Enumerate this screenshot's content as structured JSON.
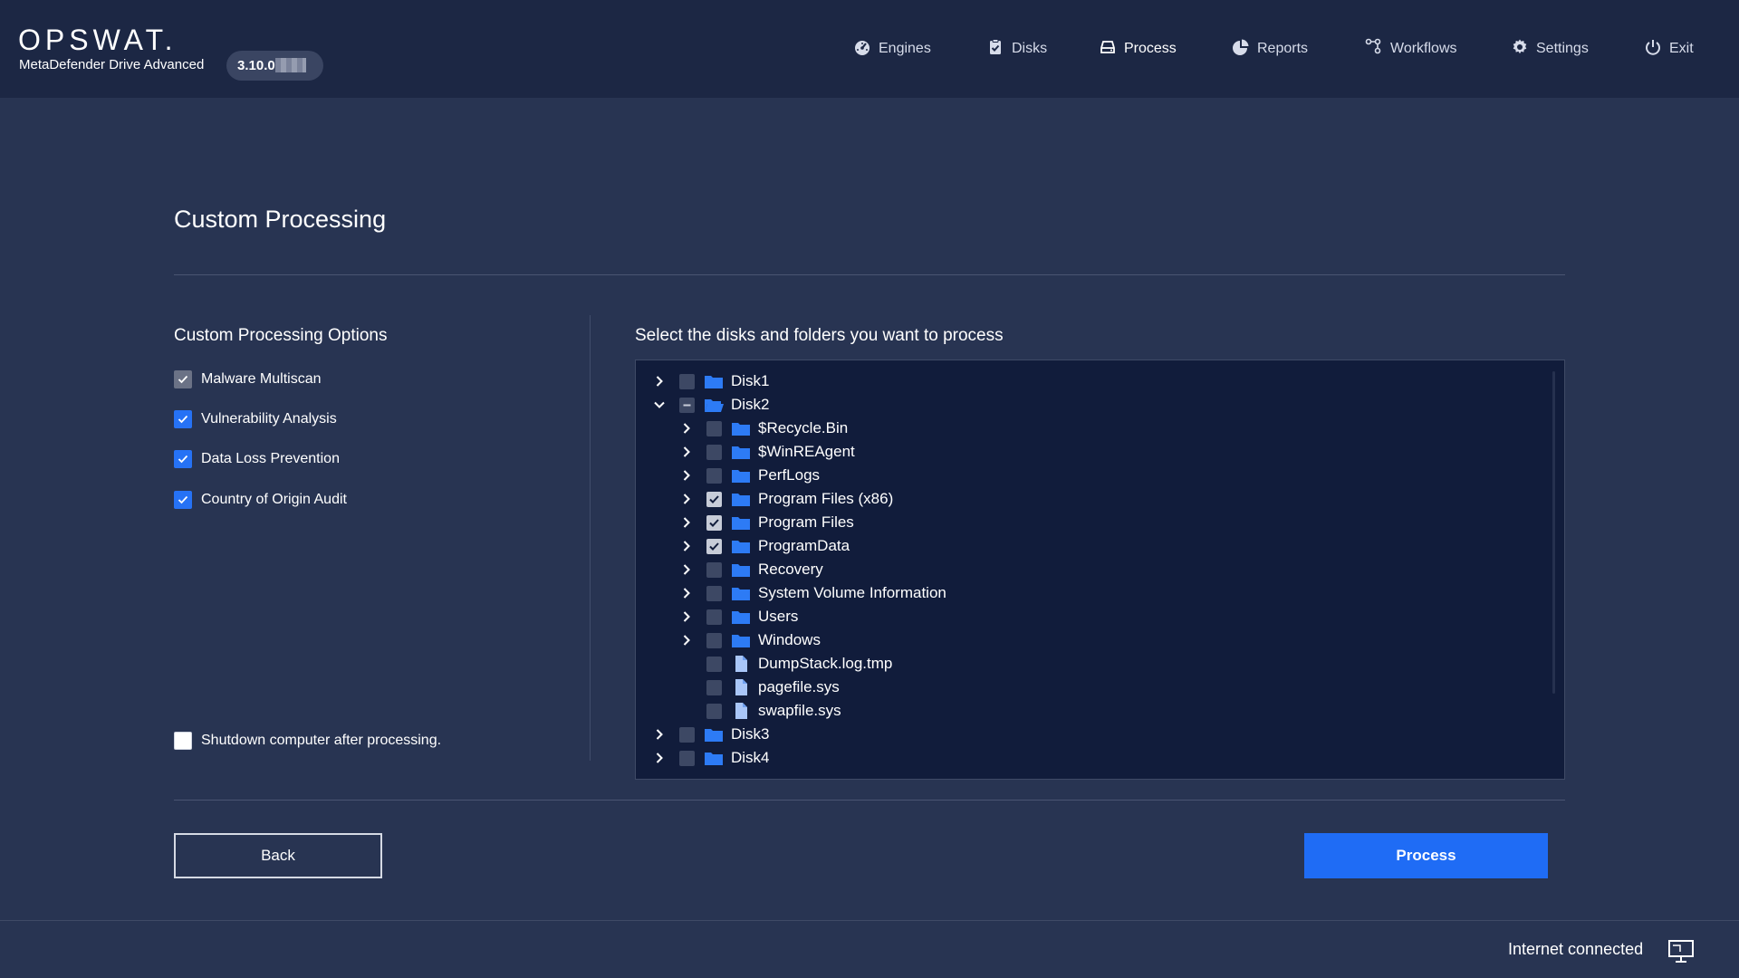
{
  "header": {
    "logo": "OPSWAT.",
    "product": "MetaDefender Drive Advanced",
    "version": "3.10.0",
    "nav": [
      {
        "label": "Engines",
        "icon": "gauge-icon"
      },
      {
        "label": "Disks",
        "icon": "clipboard-check-icon"
      },
      {
        "label": "Process",
        "icon": "drive-icon"
      },
      {
        "label": "Reports",
        "icon": "pie-chart-icon"
      },
      {
        "label": "Workflows",
        "icon": "workflow-icon"
      },
      {
        "label": "Settings",
        "icon": "gear-icon"
      },
      {
        "label": "Exit",
        "icon": "power-icon"
      }
    ],
    "active_nav": "Process"
  },
  "page": {
    "title": "Custom Processing"
  },
  "options": {
    "title": "Custom Processing Options",
    "items": [
      {
        "label": "Malware Multiscan",
        "checked": true,
        "style": "disabled"
      },
      {
        "label": "Vulnerability Analysis",
        "checked": true
      },
      {
        "label": "Data Loss Prevention",
        "checked": true
      },
      {
        "label": "Country of Origin Audit",
        "checked": true
      }
    ],
    "shutdown": {
      "label": "Shutdown computer after processing.",
      "checked": false
    }
  },
  "tree": {
    "title": "Select the disks and folders you want to process",
    "rows": [
      {
        "label": "Disk1",
        "level": 0,
        "type": "folder",
        "expanded": false,
        "state": "unchecked"
      },
      {
        "label": "Disk2",
        "level": 0,
        "type": "folder-open",
        "expanded": true,
        "state": "partial"
      },
      {
        "label": "$Recycle.Bin",
        "level": 1,
        "type": "folder",
        "expanded": false,
        "state": "unchecked"
      },
      {
        "label": "$WinREAgent",
        "level": 1,
        "type": "folder",
        "expanded": false,
        "state": "unchecked"
      },
      {
        "label": "PerfLogs",
        "level": 1,
        "type": "folder",
        "expanded": false,
        "state": "unchecked"
      },
      {
        "label": "Program Files (x86)",
        "level": 1,
        "type": "folder",
        "expanded": false,
        "state": "checked"
      },
      {
        "label": "Program Files",
        "level": 1,
        "type": "folder",
        "expanded": false,
        "state": "checked"
      },
      {
        "label": "ProgramData",
        "level": 1,
        "type": "folder",
        "expanded": false,
        "state": "checked"
      },
      {
        "label": "Recovery",
        "level": 1,
        "type": "folder",
        "expanded": false,
        "state": "unchecked"
      },
      {
        "label": "System Volume Information",
        "level": 1,
        "type": "folder",
        "expanded": false,
        "state": "unchecked"
      },
      {
        "label": "Users",
        "level": 1,
        "type": "folder",
        "expanded": false,
        "state": "unchecked"
      },
      {
        "label": "Windows",
        "level": 1,
        "type": "folder",
        "expanded": false,
        "state": "unchecked"
      },
      {
        "label": "DumpStack.log.tmp",
        "level": 1,
        "type": "file",
        "state": "unchecked"
      },
      {
        "label": "pagefile.sys",
        "level": 1,
        "type": "file",
        "state": "unchecked"
      },
      {
        "label": "swapfile.sys",
        "level": 1,
        "type": "file",
        "state": "unchecked"
      },
      {
        "label": "Disk3",
        "level": 0,
        "type": "folder",
        "expanded": false,
        "state": "unchecked"
      },
      {
        "label": "Disk4",
        "level": 0,
        "type": "folder",
        "expanded": false,
        "state": "unchecked"
      }
    ]
  },
  "buttons": {
    "back": "Back",
    "process": "Process"
  },
  "footer": {
    "status": "Internet connected",
    "status_icon": "monitor-icon"
  },
  "colors": {
    "accent": "#1f6cf5",
    "folder": "#2d7bf5",
    "background": "#283452",
    "header": "#1c2744",
    "tree_bg": "#111c3b"
  }
}
